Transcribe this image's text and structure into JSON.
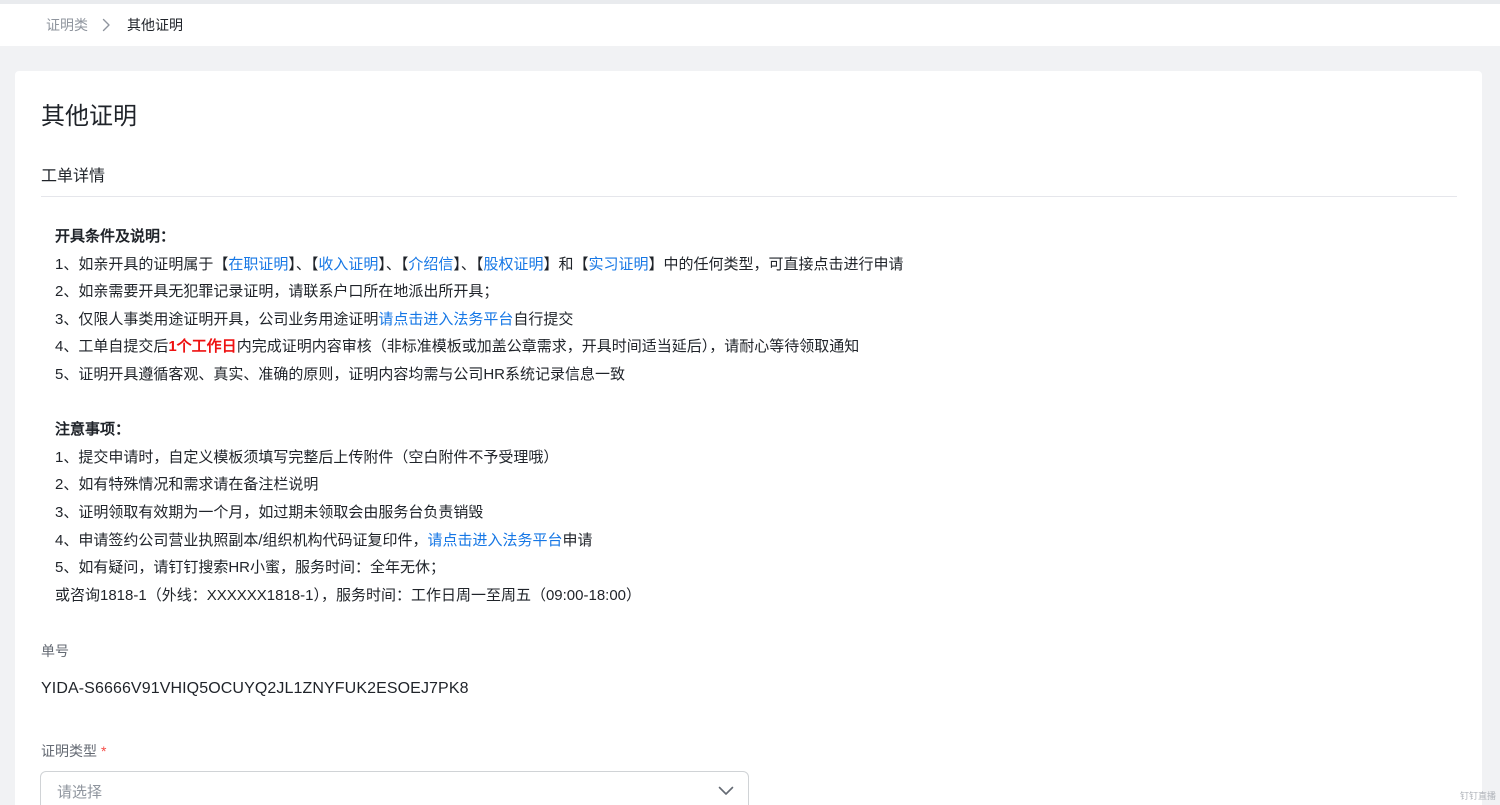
{
  "breadcrumb": {
    "parent": "证明类",
    "current": "其他证明"
  },
  "page": {
    "title": "其他证明",
    "section_title": "工单详情"
  },
  "info": {
    "conditions_heading": "开具条件及说明：",
    "line1": {
      "prefix": "1、如亲开具的证明属于【",
      "link1": "在职证明",
      "sep1": "】、【",
      "link2": "收入证明",
      "sep2": "】、【",
      "link3": "介绍信",
      "sep3": "】、【",
      "link4": "股权证明",
      "sep4": "】和【",
      "link5": "实习证明",
      "suffix": "】中的任何类型，可直接点击进行申请"
    },
    "line2": "2、如亲需要开具无犯罪记录证明，请联系户口所在地派出所开具；",
    "line3": {
      "prefix": "3、仅限人事类用途证明开具，公司业务用途证明",
      "link": "请点击进入法务平台",
      "suffix": "自行提交"
    },
    "line4": {
      "prefix": "4、工单自提交后",
      "highlight": "1个工作日",
      "suffix": "内完成证明内容审核（非标准模板或加盖公章需求，开具时间适当延后），请耐心等待领取通知"
    },
    "line5": "5、证明开具遵循客观、真实、准确的原则，证明内容均需与公司HR系统记录信息一致",
    "notes_heading": "注意事项：",
    "note1": "1、提交申请时，自定义模板须填写完整后上传附件（空白附件不予受理哦）",
    "note2": "2、如有特殊情况和需求请在备注栏说明",
    "note3": "3、证明领取有效期为一个月，如过期未领取会由服务台负责销毁",
    "note4": {
      "prefix": "4、申请签约公司营业执照副本/组织机构代码证复印件，",
      "link": "请点击进入法务平台",
      "suffix": "申请"
    },
    "note5": "5、如有疑问，请钉钉搜索HR小蜜，服务时间：全年无休；",
    "note6": "或咨询1818-1（外线：XXXXXX1818-1），服务时间：工作日周一至周五（09:00-18:00）"
  },
  "form": {
    "order_label": "单号",
    "order_value": "YIDA-S6666V91VHIQ5OCUYQ2JL1ZNYFUK2ESOEJ7PK8",
    "type_label": "证明类型",
    "required_mark": "*",
    "type_placeholder": "请选择"
  },
  "watermark": "钉钉直播",
  "colors": {
    "link": "#1677e5",
    "highlight": "#ee1111",
    "required": "#f54a45"
  }
}
